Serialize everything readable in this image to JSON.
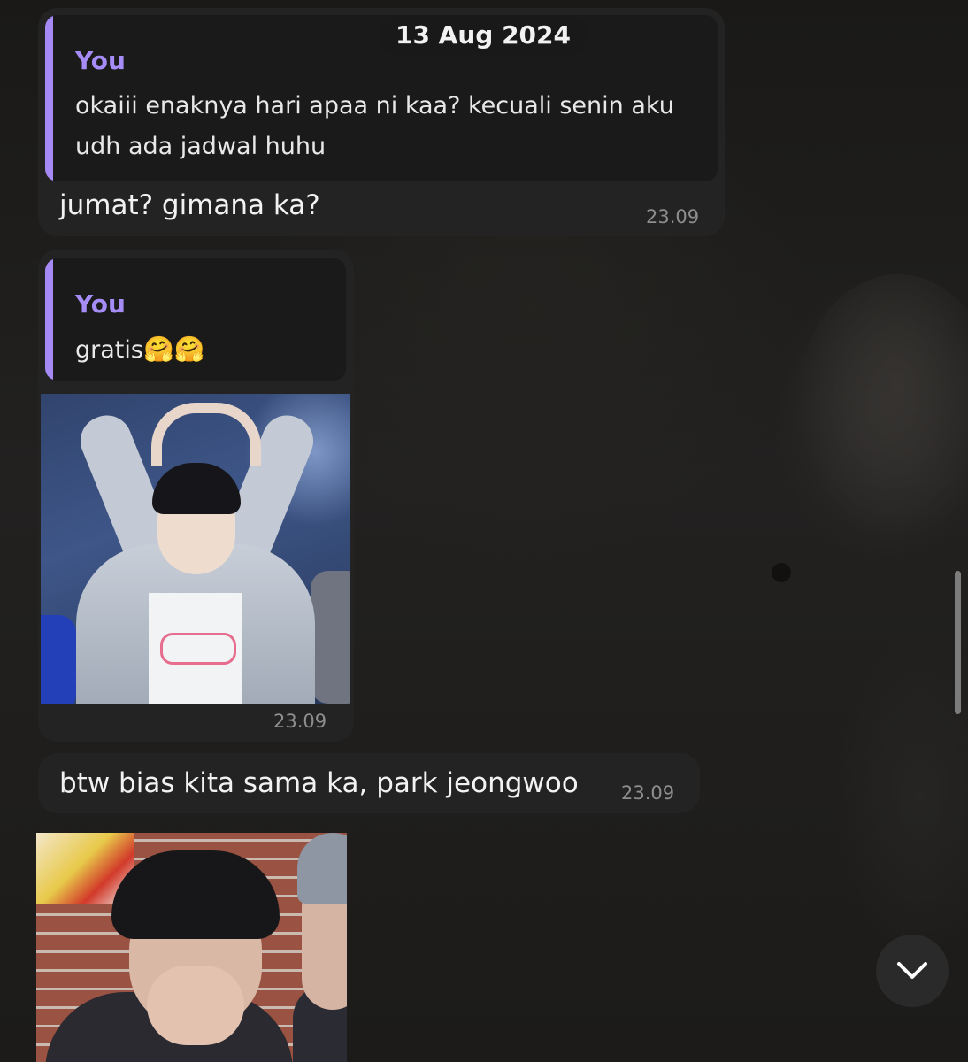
{
  "date_separator": "13 Aug 2024",
  "messages": [
    {
      "reply": {
        "name": "You",
        "text": "okaiii enaknya hari apaa ni kaa? kecuali senin aku udh ada jadwal huhu"
      },
      "text": "jumat? gimana ka?",
      "time": "23.09"
    },
    {
      "reply": {
        "name": "You",
        "text": "gratis",
        "emoji": "🤗🤗"
      },
      "media": "photo",
      "time": "23.09"
    },
    {
      "text": "btw bias kita sama ka, park jeongwoo",
      "time": "23.09"
    },
    {
      "media": "photo"
    }
  ],
  "icons": {
    "scroll_down": "chevron-down-icon"
  },
  "colors": {
    "accent": "#a68cf6",
    "bubble": "#232323",
    "quote_bg": "#1a1a1a",
    "timestamp": "#8e8e8e"
  }
}
